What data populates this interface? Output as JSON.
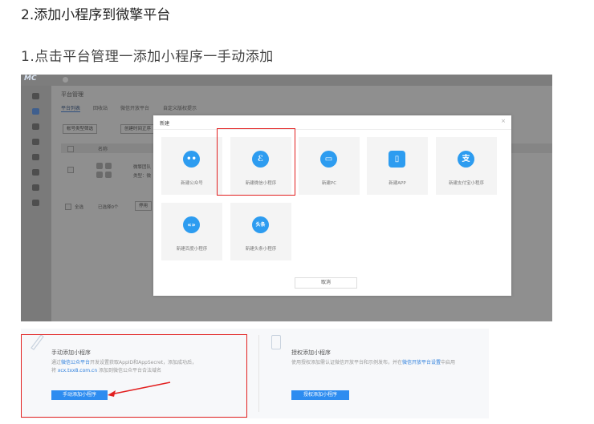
{
  "heading_step": "2.添加小程序到微擎平台",
  "heading_sub": "1.点击平台管理一添加小程序一手动添加",
  "shot1": {
    "logo": "MC",
    "page_title": "平台管理",
    "tabs": [
      "平台列表",
      "回收站",
      "微信开放平台",
      "自定义版权提示"
    ],
    "filter_buttons": [
      "帐号类型筛选",
      "创建时间正序"
    ],
    "table_header": "名称",
    "row_name": "微擎团队",
    "row_type": "类型：微",
    "select_all": "全选",
    "selected_count": "已选择0个",
    "bulk_action": "停用",
    "modal": {
      "title": "新建",
      "close": "×",
      "cards": [
        {
          "label": "新建公众号",
          "icon": "wechat-icon",
          "glyph": "••"
        },
        {
          "label": "新建微信小程序",
          "icon": "mini-program-icon",
          "glyph": "ℰ"
        },
        {
          "label": "新建PC",
          "icon": "monitor-icon",
          "glyph": "▭"
        },
        {
          "label": "新建APP",
          "icon": "phone-icon",
          "glyph": "▯"
        },
        {
          "label": "新建支付宝小程序",
          "icon": "alipay-icon",
          "glyph": "支"
        },
        {
          "label": "新建百度小程序",
          "icon": "baidu-icon",
          "glyph": "«»"
        },
        {
          "label": "新建头条小程序",
          "icon": "toutiao-icon",
          "glyph": "头条"
        }
      ],
      "cancel": "取消"
    }
  },
  "shot2": {
    "manual": {
      "title": "手动添加小程序",
      "desc_1": "通过",
      "desc_link": "微信公众平台",
      "desc_2": "开发设置获取AppID和AppSecret，添加成功后，",
      "desc_3": "将 ",
      "desc_domain": "xcx.txx8.com.cn",
      "desc_4": " 添加到微信公众平台合法域名",
      "button": "手动添加小程序"
    },
    "auth": {
      "title": "授权添加小程序",
      "desc_1": "使用授权添加需认证微信开放平台和示例发布，并在",
      "desc_link": "微信开放平台设置",
      "desc_2": "中启用",
      "button": "授权添加小程序"
    }
  },
  "colors": {
    "highlight": "#e21f1f",
    "primary": "#2d8cf0"
  }
}
